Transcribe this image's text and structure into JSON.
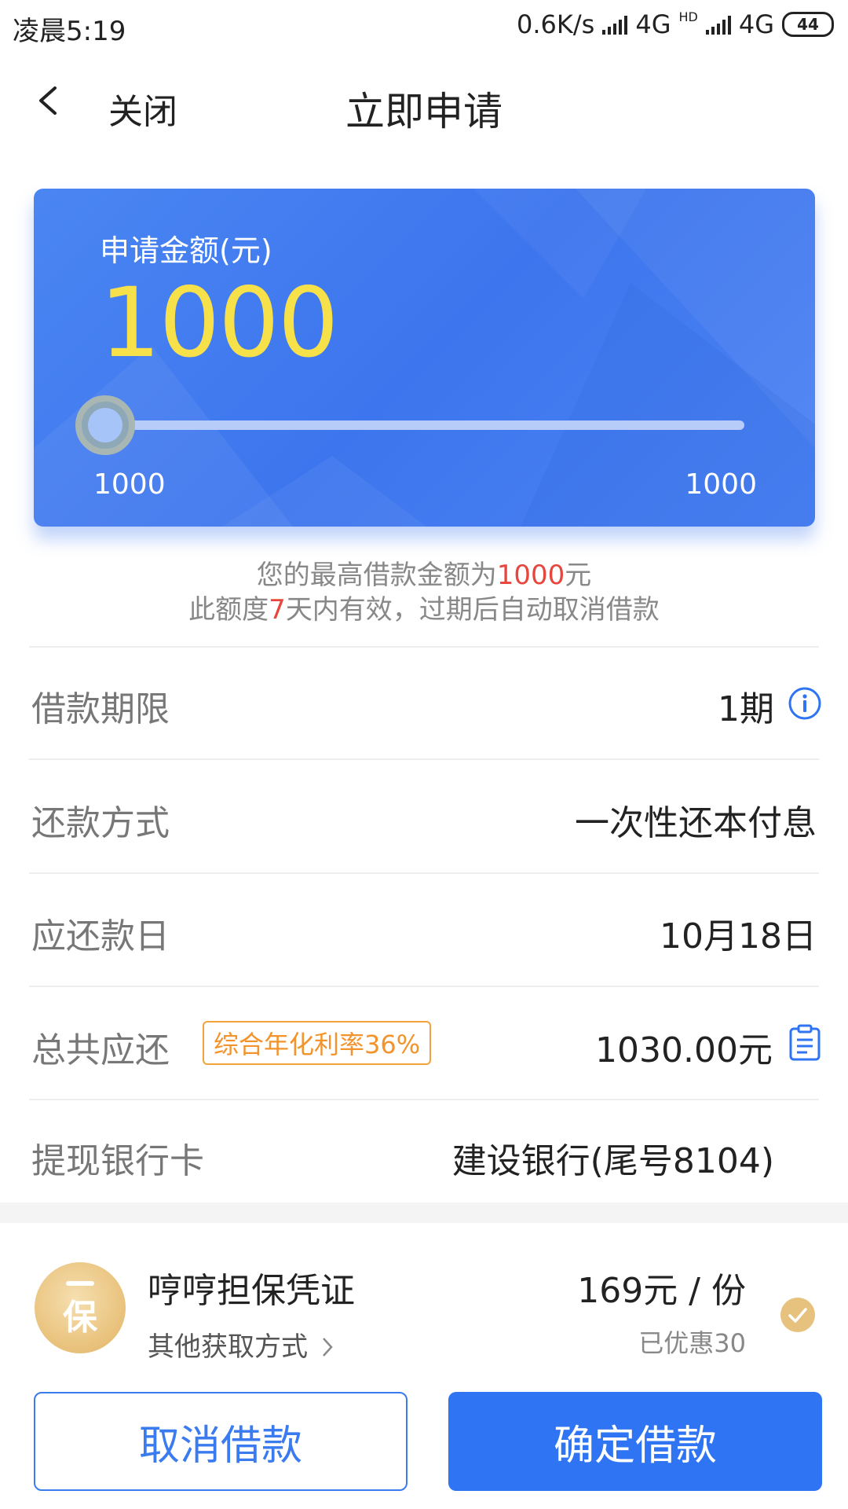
{
  "status_bar": {
    "time": "凌晨5:19",
    "network_speed": "0.6K/s",
    "network1": "4G",
    "hd": "HD",
    "network2": "4G",
    "battery": "44"
  },
  "header": {
    "back_icon": "chevron-left-icon",
    "close_label": "关闭",
    "title": "立即申请"
  },
  "amount_card": {
    "label": "申请金额(元)",
    "value": "1000",
    "slider": {
      "min_label": "1000",
      "max_label": "1000",
      "level": 0
    },
    "colors": {
      "background": "#4a86f2",
      "amount": "#f7e14a"
    }
  },
  "notes": {
    "line1_prefix": "您的最高借款金额为",
    "line1_amount": "1000",
    "line1_suffix": "元",
    "line2_prefix": "此额度",
    "line2_days": "7",
    "line2_suffix": "天内有效，过期后自动取消借款"
  },
  "rows": {
    "term": {
      "label": "借款期限",
      "value": "1期",
      "icon": "info-icon"
    },
    "repay_method": {
      "label": "还款方式",
      "value": "一次性还本付息"
    },
    "due_date": {
      "label": "应还款日",
      "value": "10月18日"
    },
    "total": {
      "label": "总共应还",
      "badge": "综合年化利率36%",
      "value": "1030.00元",
      "icon": "clipboard-icon"
    },
    "bank_card": {
      "label": "提现银行卡",
      "value": "建设银行(尾号8104)"
    }
  },
  "guarantee": {
    "icon_char": "保",
    "title": "哼哼担保凭证",
    "link": "其他获取方式",
    "price": "169元 / 份",
    "discount": "已优惠30",
    "checked": true
  },
  "buttons": {
    "cancel": "取消借款",
    "confirm": "确定借款"
  },
  "colors": {
    "accent": "#2f74f2",
    "warning": "#f3932c",
    "highlight": "#e8453c",
    "gold": "#e7c27f"
  }
}
